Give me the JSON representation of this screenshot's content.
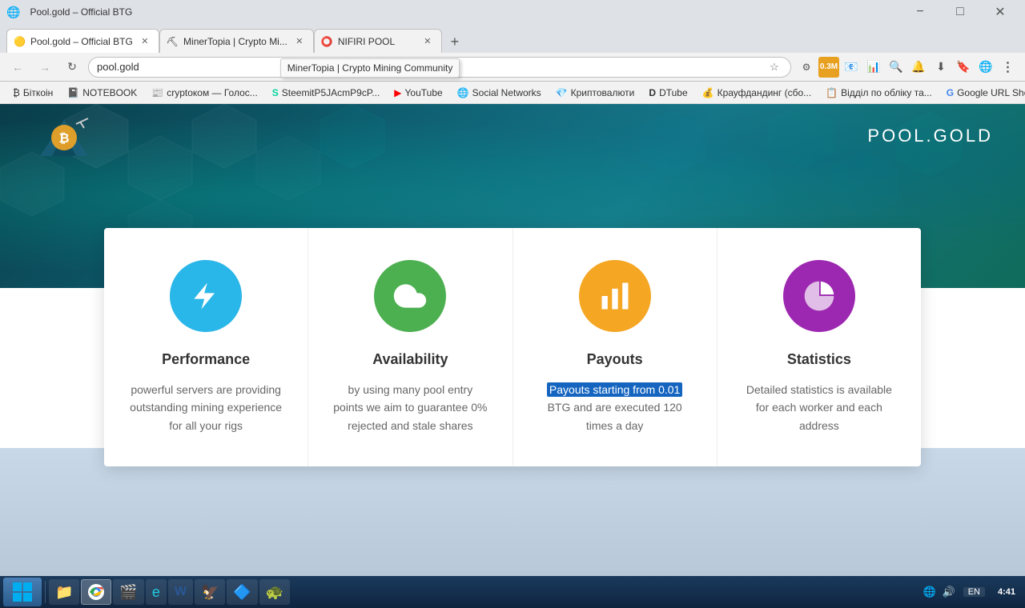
{
  "browser": {
    "tabs": [
      {
        "id": "tab1",
        "title": "Pool.gold – Official BTG",
        "favicon": "🟡",
        "active": true,
        "closeable": true
      },
      {
        "id": "tab2",
        "title": "MinerTopia | Crypto Mi...",
        "favicon": "⛏",
        "active": false,
        "closeable": true,
        "tooltip": "MinerTopia | Crypto Mining Community"
      },
      {
        "id": "tab3",
        "title": "NIFIRI POOL",
        "favicon": "🔵",
        "active": false,
        "closeable": true
      }
    ],
    "address": "pool.gold",
    "nav": {
      "back_disabled": false,
      "forward_disabled": true
    }
  },
  "bookmarks": [
    {
      "id": "bm1",
      "label": "Біткоін",
      "favicon": "₿"
    },
    {
      "id": "bm2",
      "label": "NOTEBOOK",
      "favicon": "📓"
    },
    {
      "id": "bm3",
      "label": "cryptoком — Голос...",
      "favicon": "📰"
    },
    {
      "id": "bm4",
      "label": "SteemitP5JAcmP9cP...",
      "favicon": "S"
    },
    {
      "id": "bm5",
      "label": "YouTube",
      "favicon": "▶"
    },
    {
      "id": "bm6",
      "label": "Social Networks",
      "favicon": "🌐"
    },
    {
      "id": "bm7",
      "label": "Криптовалюти",
      "favicon": "💎"
    },
    {
      "id": "bm8",
      "label": "DTube",
      "favicon": "D"
    },
    {
      "id": "bm9",
      "label": "Крауфдандинг (сбо...",
      "favicon": "💰"
    },
    {
      "id": "bm10",
      "label": "Відділ по обліку та...",
      "favicon": "📋"
    },
    {
      "id": "bm11",
      "label": "Google URL Shorte...",
      "favicon": "G"
    }
  ],
  "site": {
    "title": "POOL.GOLD",
    "logo_alt": "Pool.gold logo"
  },
  "features": [
    {
      "id": "performance",
      "icon_type": "lightning",
      "icon_color": "blue",
      "title": "Performance",
      "description": "powerful servers are providing outstanding mining experience for all your rigs",
      "highlight": null
    },
    {
      "id": "availability",
      "icon_type": "cloud",
      "icon_color": "green",
      "title": "Availability",
      "description": "by using many pool entry points we aim to guarantee 0% rejected and stale shares",
      "highlight": null
    },
    {
      "id": "payouts",
      "icon_type": "chart",
      "icon_color": "yellow",
      "title": "Payouts",
      "description_line1": "Payouts starting from 0.01",
      "description_line2": "BTG and are executed 120 times a day",
      "highlight": "Payouts starting from 0.01"
    },
    {
      "id": "statistics",
      "icon_type": "pie",
      "icon_color": "purple",
      "title": "Statistics",
      "description": "Detailed statistics is available for each worker and each address",
      "highlight": null
    }
  ],
  "taskbar": {
    "items": [
      {
        "id": "tb1",
        "label": "",
        "icon": "start"
      },
      {
        "id": "tb2",
        "label": "",
        "icon": "folder"
      },
      {
        "id": "tb3",
        "label": "",
        "icon": "chrome"
      },
      {
        "id": "tb4",
        "label": "",
        "icon": "media"
      },
      {
        "id": "tb5",
        "label": "",
        "icon": "explorer"
      },
      {
        "id": "tb6",
        "label": "",
        "icon": "word"
      },
      {
        "id": "tb7",
        "label": "",
        "icon": "app1"
      },
      {
        "id": "tb8",
        "label": "",
        "icon": "app2"
      },
      {
        "id": "tb9",
        "label": "",
        "icon": "app3"
      }
    ],
    "clock": {
      "time": "4:41",
      "date": ""
    },
    "lang": "EN"
  }
}
